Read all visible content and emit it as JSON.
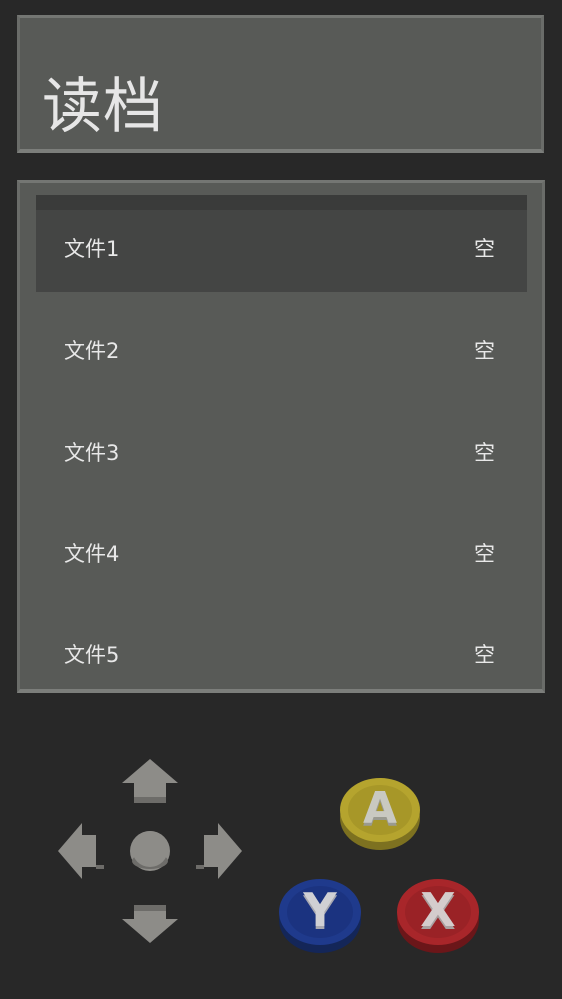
{
  "header": {
    "title": "读档"
  },
  "save_slots": [
    {
      "name": "文件1",
      "status": "空",
      "selected": true
    },
    {
      "name": "文件2",
      "status": "空",
      "selected": false
    },
    {
      "name": "文件3",
      "status": "空",
      "selected": false
    },
    {
      "name": "文件4",
      "status": "空",
      "selected": false
    },
    {
      "name": "文件5",
      "status": "空",
      "selected": false
    }
  ],
  "controls": {
    "dpad_icon": "dpad-icon",
    "buttons": [
      {
        "label": "A",
        "color": "#b5a42e"
      },
      {
        "label": "Y",
        "color": "#1f3a8c"
      },
      {
        "label": "X",
        "color": "#a8262a"
      }
    ]
  },
  "colors": {
    "background": "#282828",
    "panel": "#585a57",
    "selected_row": "#444544",
    "text": "#e8e8e8"
  }
}
